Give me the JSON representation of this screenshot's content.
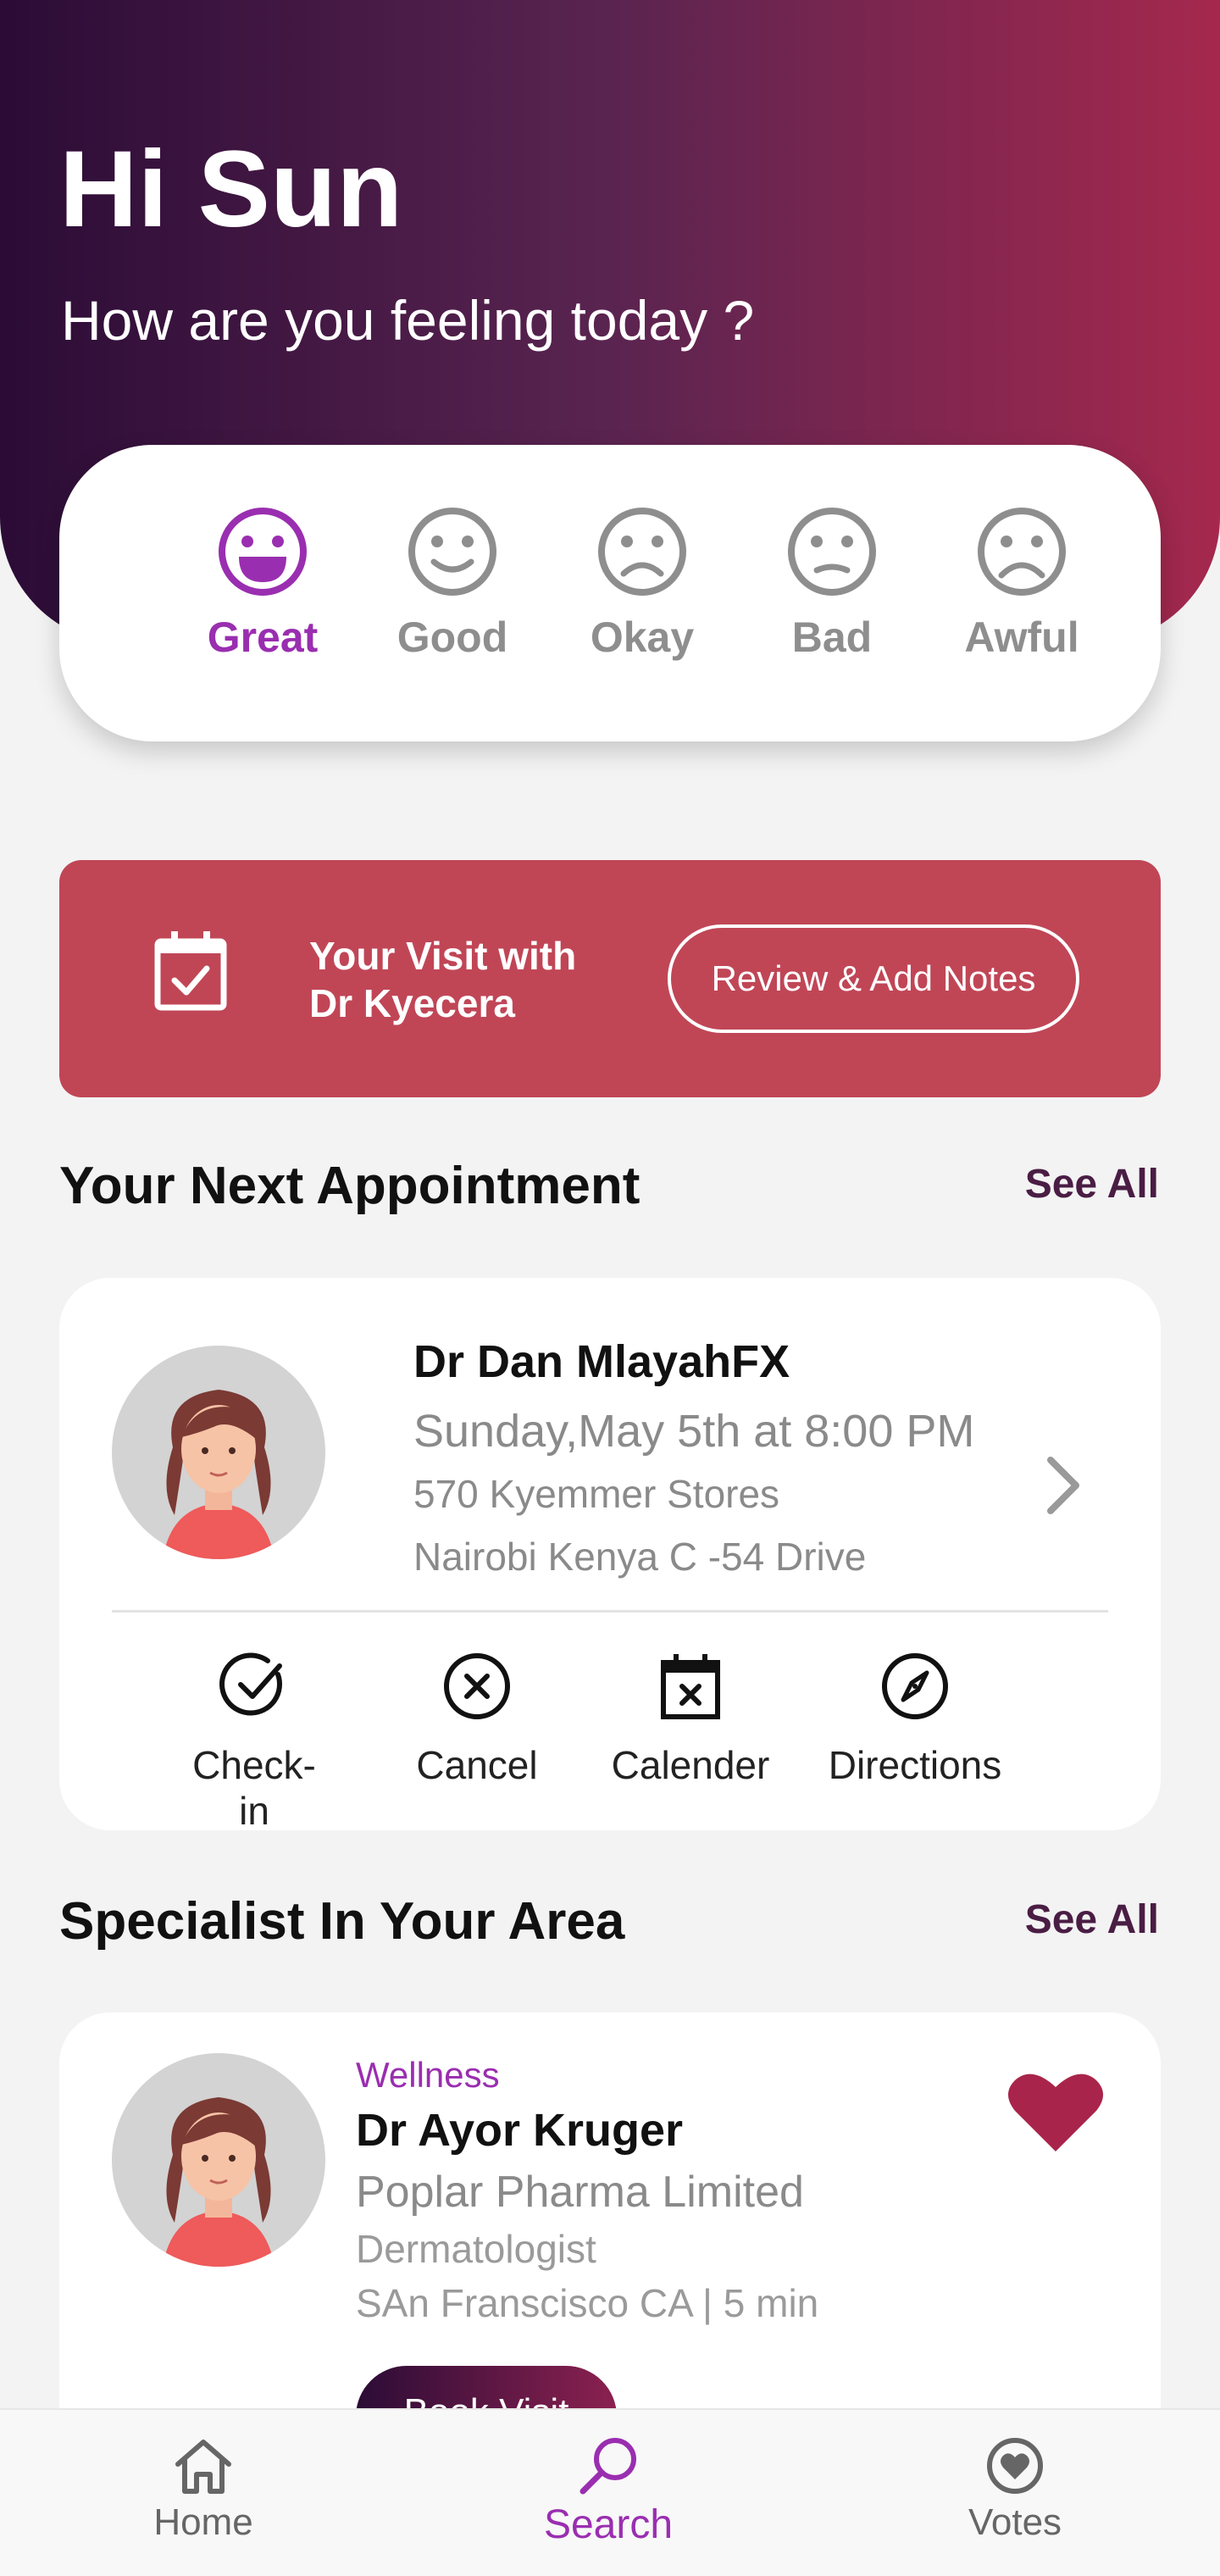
{
  "header": {
    "greeting": "Hi Sun",
    "subtitle": "How are you feeling today ?"
  },
  "moods": [
    {
      "label": "Great",
      "icon": "great-face-icon",
      "selected": true
    },
    {
      "label": "Good",
      "icon": "good-face-icon",
      "selected": false
    },
    {
      "label": "Okay",
      "icon": "okay-face-icon",
      "selected": false
    },
    {
      "label": "Bad",
      "icon": "bad-face-icon",
      "selected": false
    },
    {
      "label": "Awful",
      "icon": "awful-face-icon",
      "selected": false
    }
  ],
  "visit_banner": {
    "icon": "calendar-check-icon",
    "title_line1": "Your Visit with",
    "title_line2": "Dr Kyecera",
    "button_label": "Review & Add Notes"
  },
  "next_appointment": {
    "section_title": "Your Next Appointment",
    "see_all": "See All",
    "doctor_name": "Dr Dan MlayahFX",
    "datetime": "Sunday,May 5th at 8:00 PM",
    "address_line1": "570 Kyemmer Stores",
    "address_line2": "Nairobi Kenya C -54 Drive",
    "actions": [
      {
        "label": "Check-in",
        "icon": "check-circle-icon"
      },
      {
        "label": "Cancel",
        "icon": "cancel-circle-icon"
      },
      {
        "label": "Calender",
        "icon": "calendar-x-icon"
      },
      {
        "label": "Directions",
        "icon": "compass-icon"
      }
    ]
  },
  "specialists": {
    "section_title": "Specialist In Your Area",
    "see_all": "See All",
    "items": [
      {
        "category": "Wellness",
        "name": "Dr Ayor Kruger",
        "organization": "Poplar Pharma Limited",
        "specialty": "Dermatologist",
        "location": "SAn Franscisco CA | 5 min",
        "button_label": "Book Visit",
        "favorited": true
      }
    ]
  },
  "bottom_nav": [
    {
      "label": "Home",
      "icon": "home-icon",
      "active": false
    },
    {
      "label": "Search",
      "icon": "search-icon",
      "active": true
    },
    {
      "label": "Votes",
      "icon": "heart-circle-icon",
      "active": false
    }
  ],
  "colors": {
    "brand_dark": "#2b0c36",
    "brand_red": "#a5284e",
    "accent_purple": "#9a2eb0",
    "banner_red": "#c04656",
    "heart": "#a9244b"
  }
}
